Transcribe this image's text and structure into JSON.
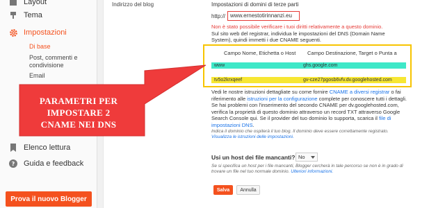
{
  "sidebar": {
    "layout_label": "Layout",
    "tema_label": "Tema",
    "impostazioni_label": "Impostazioni",
    "sub_items": [
      "Di base",
      "Post, commenti e condivisione",
      "Email"
    ],
    "elenco_label": "Elenco lettura",
    "guida_label": "Guida e feedback",
    "try_button": "Prova il nuovo Blogger"
  },
  "main": {
    "section_label": "Indirizzo del blog",
    "panel_title": "Impostazioni di domini di terze parti",
    "url_prefix": "http://",
    "url_value": "www.ernestotirinnanzi.eu",
    "error_text": "Non è stato possibile verificare i tuoi diritti relativamente a questo dominio.",
    "info1": "Sul sito web del registrar, individua le impostazioni del DNS (Domain Name System), quindi immetti i due CNAME seguenti.",
    "dns": {
      "header_name": "Campo Nome, Etichetta o Host",
      "header_dest": "Campo Destinazione, Target o Punta a",
      "rows": [
        {
          "name": "www",
          "dest": "ghs.google.com"
        },
        {
          "name": "tv5o2krxqeef",
          "dest": "gv-cze27pgosb6vfv.dv.googlehosted.com"
        }
      ]
    },
    "info2_a": "Vedi le nostre istruzioni dettagliate su come fornire ",
    "info2_link1": "CNAME a diversi registrar",
    "info2_b": " o fai riferimento alle ",
    "info2_link2": "istruzioni per la configurazione",
    "info2_c": " complete per conoscere tutti i dettagli. Se hai problemi con l'inserimento del secondo CNAME per dv.googlehosted.com, verifica la proprietà di questo dominio attraverso un record TXT attraverso Google Search Console qui. Se il provider del tuo dominio lo supporta, scarica il ",
    "info2_link3": "file di impostazioni DNS",
    "info2_d": ".",
    "note1_a": "Indica il dominio che ospiterà il tuo blog. Il dominio deve essere correttamente registrato. ",
    "note1_link": "Visualizza le istruzioni delle impostazioni.",
    "question": "Usi un host dei file mancanti?",
    "select_value": "No",
    "note2_a": "Se si specifica un host per i file mancanti, Blogger cercherà in tale percorso se non è in grado di trovare un file nel tuo normale dominio. ",
    "note2_link": "Ulteriori informazioni.",
    "save_label": "Salva",
    "cancel_label": "Annulla"
  },
  "callout": {
    "text_lines": [
      "PARAMETRI PER",
      "IMPOSTARE 2",
      "CNAME NEI DNS"
    ],
    "fill_color": "#ef3b3b"
  },
  "colors": {
    "accent": "#f4511e",
    "error": "#e53935",
    "highlight_cyan": "#3ee8c8",
    "highlight_yellow": "#f7e733",
    "box_border": "#f7c400"
  }
}
